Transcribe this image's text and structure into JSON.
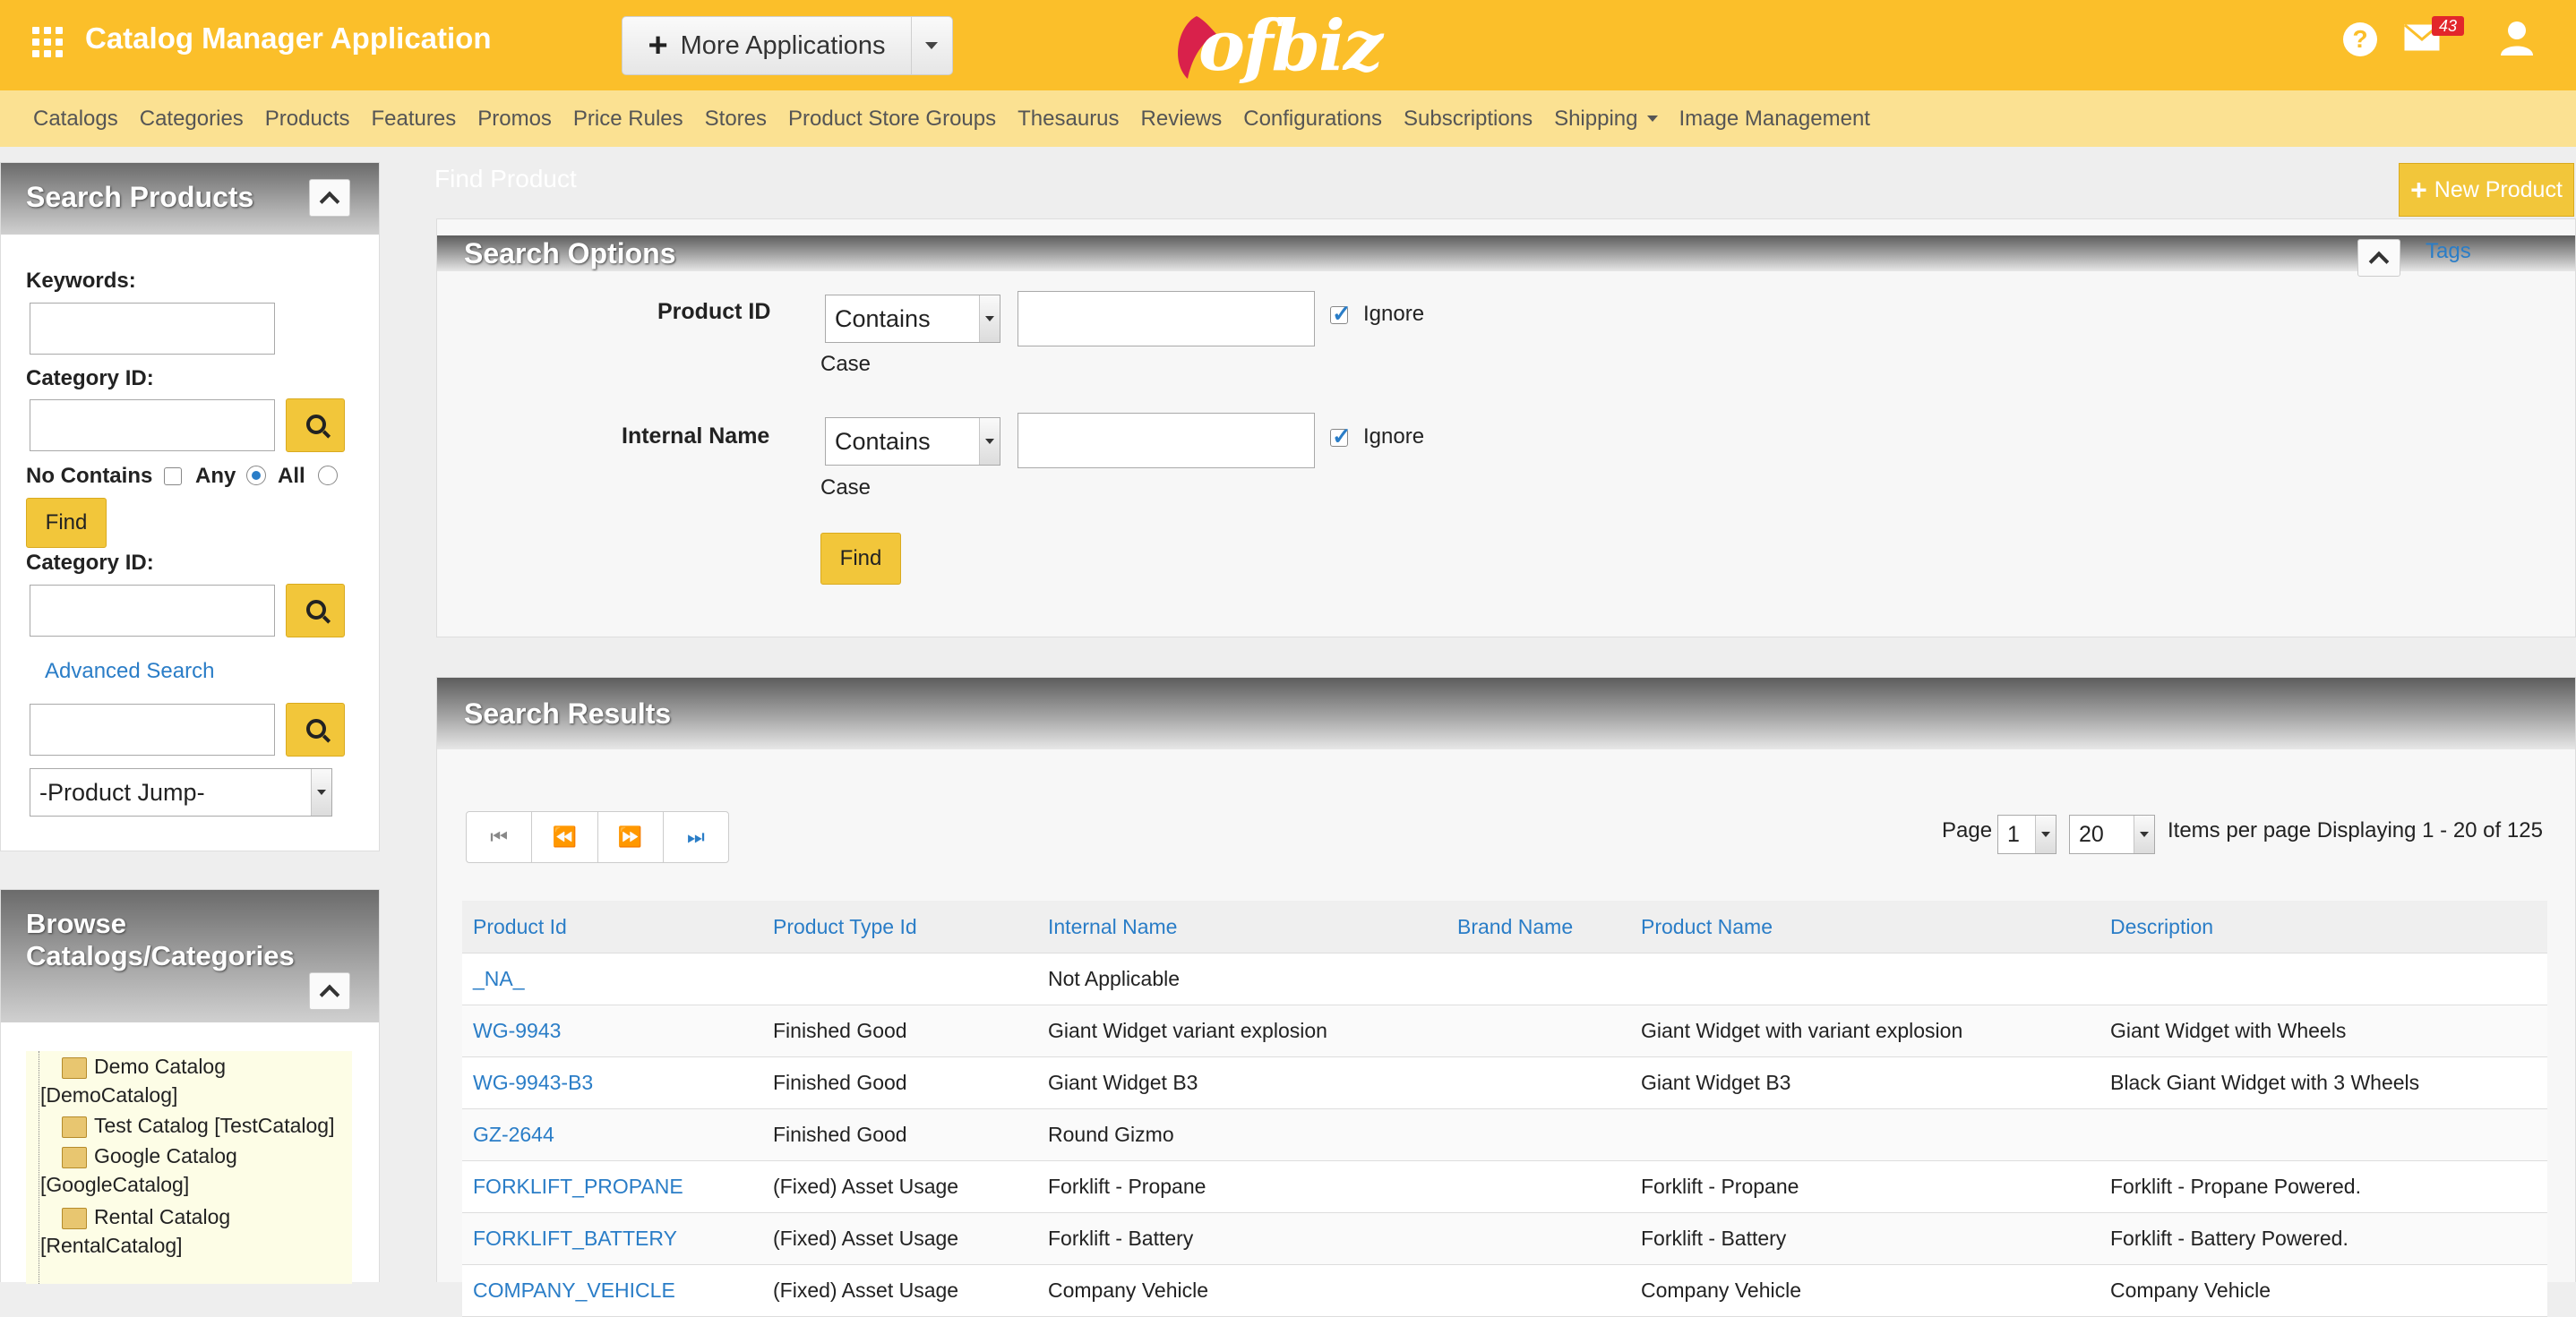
{
  "header": {
    "app_title": "Catalog Manager Application",
    "more_apps_label": "More Applications",
    "logo_text": "ofbiz",
    "mail_count": "43",
    "help_symbol": "?"
  },
  "nav": {
    "items": [
      "Catalogs",
      "Categories",
      "Products",
      "Features",
      "Promos",
      "Price Rules",
      "Stores",
      "Product Store Groups",
      "Thesaurus",
      "Reviews",
      "Configurations",
      "Subscriptions",
      "Shipping",
      "Image Management"
    ]
  },
  "sidebar": {
    "search_title": "Search Products",
    "keywords_label": "Keywords:",
    "category_label": "Category ID:",
    "no_contains_label": "No Contains",
    "any_label": "Any",
    "all_label": "All",
    "find_label": "Find",
    "category_label2": "Category ID:",
    "advanced_search_label": "Advanced Search",
    "product_jump_label": "-Product Jump-",
    "browse_title": "Browse Catalogs/Categories",
    "tree": [
      {
        "line1": "Demo Catalog",
        "line2": "[DemoCatalog]"
      },
      {
        "line1": "Test Catalog [TestCatalog]",
        "line2": ""
      },
      {
        "line1": "Google Catalog",
        "line2": "[GoogleCatalog]"
      },
      {
        "line1": "Rental Catalog",
        "line2": "[RentalCatalog]"
      }
    ]
  },
  "main": {
    "page_title": "Find Product",
    "new_product_label": "New Product",
    "search_options_title": "Search Options",
    "tags_label": "Tags",
    "product_id_label": "Product ID",
    "internal_name_label": "Internal Name",
    "contains_option": "Contains",
    "ignore_label": "Ignore",
    "case_label": "Case",
    "find_label": "Find",
    "search_results_title": "Search Results",
    "page_label": "Page",
    "page_value": "1",
    "per_page_value": "20",
    "items_label": "Items per page Displaying 1 - 20 of 125"
  },
  "table": {
    "headers": [
      "Product Id",
      "Product Type Id",
      "Internal Name",
      "Brand Name",
      "Product Name",
      "Description"
    ],
    "rows": [
      [
        "_NA_",
        "",
        "Not Applicable",
        "",
        "",
        ""
      ],
      [
        "WG-9943",
        "Finished Good",
        "Giant Widget variant explosion",
        "",
        "Giant Widget with variant explosion",
        "Giant Widget with Wheels"
      ],
      [
        "WG-9943-B3",
        "Finished Good",
        "Giant Widget B3",
        "",
        "Giant Widget B3",
        "Black Giant Widget with 3 Wheels"
      ],
      [
        "GZ-2644",
        "Finished Good",
        "Round Gizmo",
        "",
        "",
        ""
      ],
      [
        "FORKLIFT_PROPANE",
        "(Fixed) Asset Usage",
        "Forklift - Propane",
        "",
        "Forklift - Propane",
        "Forklift - Propane Powered."
      ],
      [
        "FORKLIFT_BATTERY",
        "(Fixed) Asset Usage",
        "Forklift - Battery",
        "",
        "Forklift - Battery",
        "Forklift - Battery Powered."
      ],
      [
        "COMPANY_VEHICLE",
        "(Fixed) Asset Usage",
        "Company Vehicle",
        "",
        "Company Vehicle",
        "Company Vehicle"
      ]
    ]
  },
  "colors": {
    "header_yellow": "#fbbf2a",
    "nav_yellow": "#fbe192",
    "link_blue": "#2a7dc7",
    "button_yellow": "#f2c63a"
  }
}
